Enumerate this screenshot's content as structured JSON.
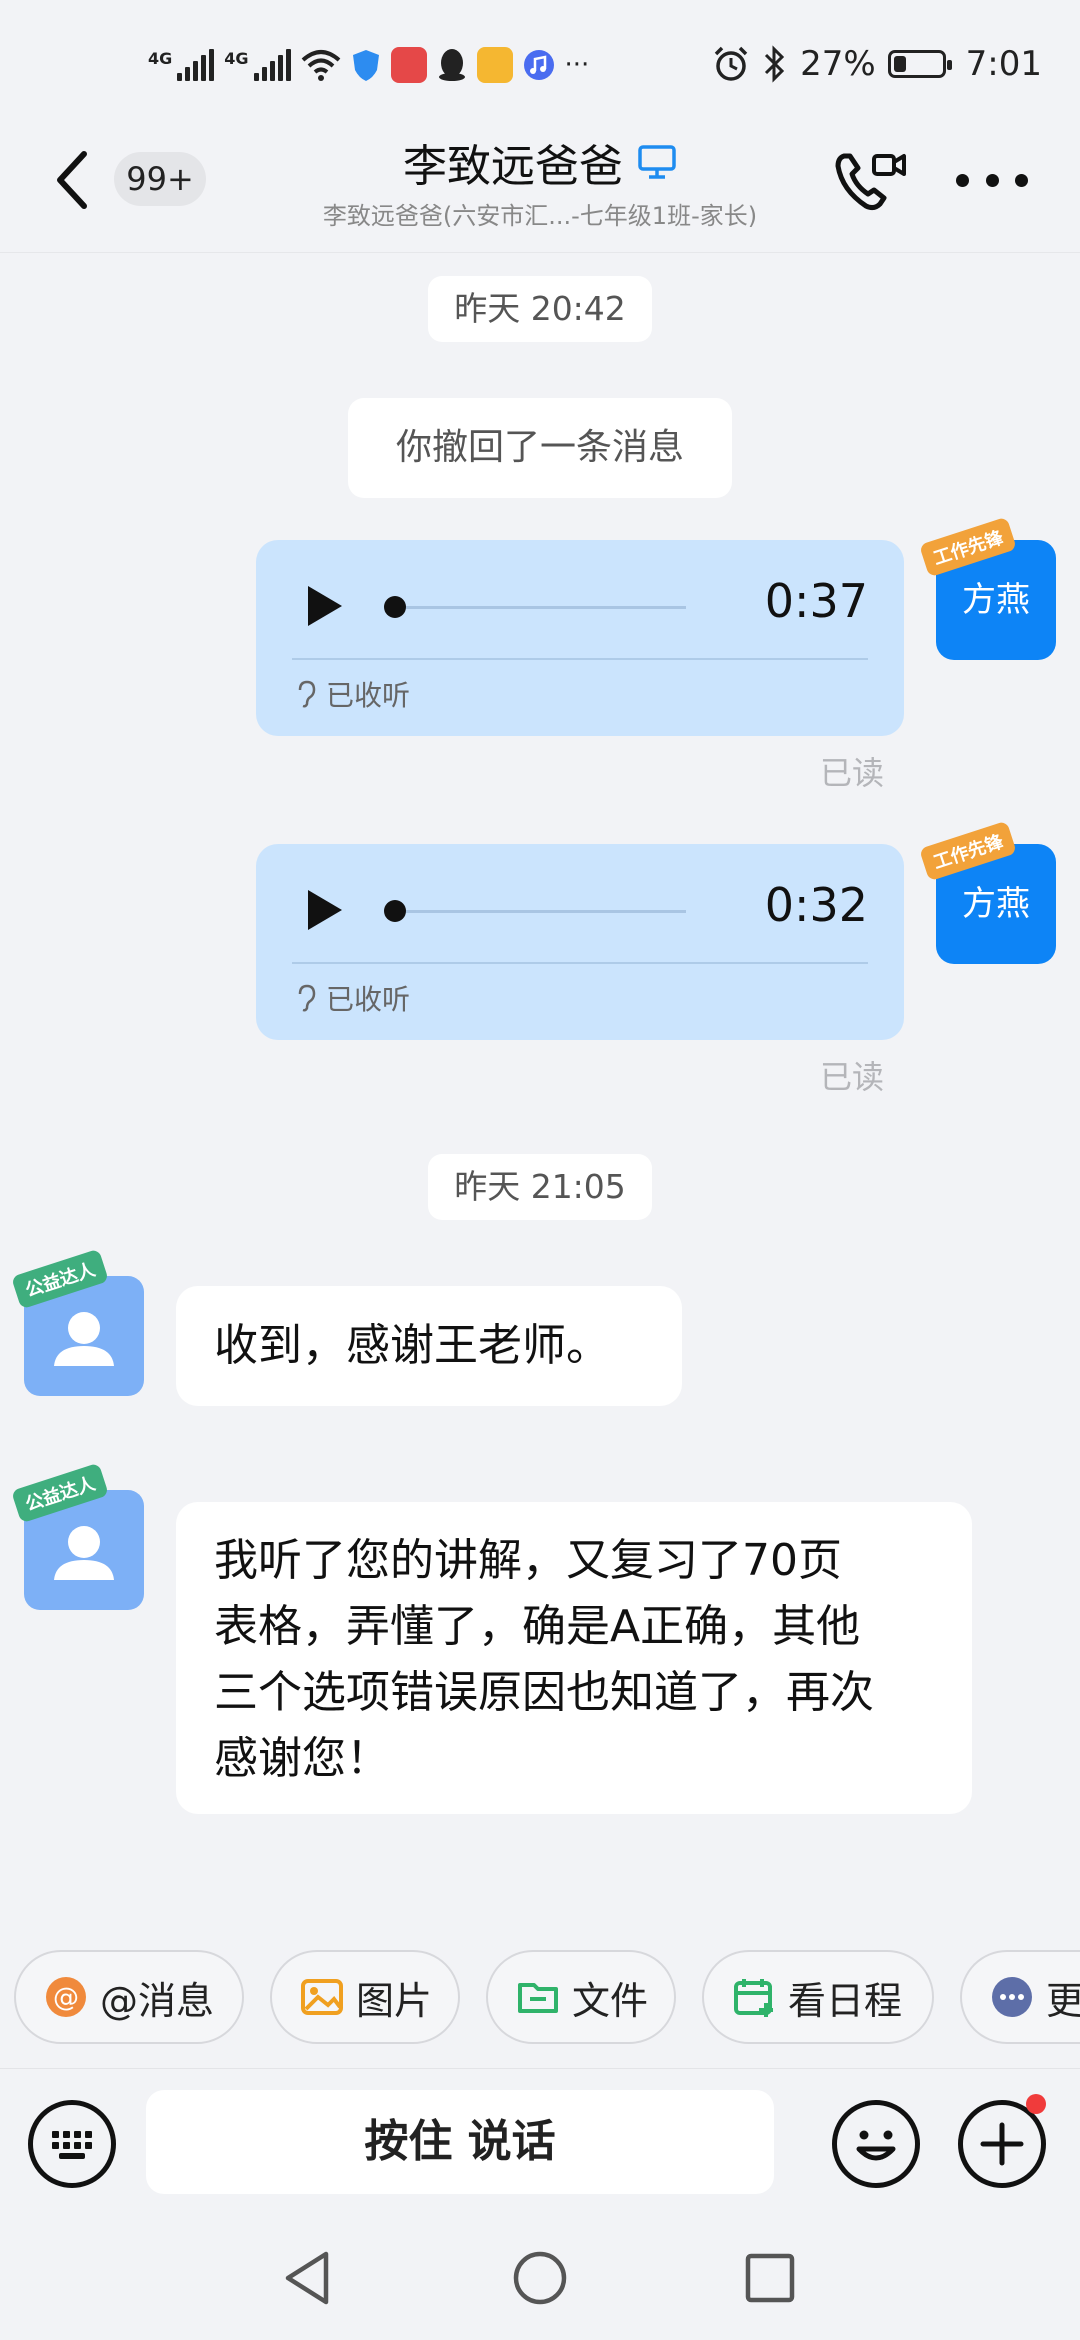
{
  "status_bar": {
    "net1": "4G",
    "net2": "4G",
    "battery_text": "27%",
    "battery_level": 0.27,
    "time": "7:01",
    "overflow": "···"
  },
  "header": {
    "back_badge": "99+",
    "title": "李致远爸爸",
    "subtitle": "李致远爸爸(六安市汇...-七年级1班-家长)"
  },
  "messages": {
    "time1": "昨天 20:42",
    "recall_notice": "你撤回了一条消息",
    "voice1": {
      "duration": "0:37",
      "heard": "已收听",
      "read": "已读",
      "sender": "方燕",
      "sender_tag": "工作先锋"
    },
    "voice2": {
      "duration": "0:32",
      "heard": "已收听",
      "read": "已读",
      "sender": "方燕",
      "sender_tag": "工作先锋"
    },
    "time2": "昨天 21:05",
    "incoming1": {
      "text": "收到，感谢王老师。",
      "avatar_tag": "公益达人"
    },
    "incoming2": {
      "lines": [
        "我听了您的讲解，又复习了70页",
        "表格，弄懂了，确是A正确，其他",
        "三个选项错误原因也知道了，再次",
        "感谢您！"
      ],
      "avatar_tag": "公益达人"
    }
  },
  "quick_actions": {
    "mention": "@消息",
    "picture": "图片",
    "file": "文件",
    "schedule": "看日程",
    "more": "更"
  },
  "input": {
    "hold_to_talk": "按住 说话"
  },
  "colors": {
    "accent": "#0d84f6",
    "voice_bubble": "#cbe4fd",
    "background": "#f2f3f6"
  }
}
